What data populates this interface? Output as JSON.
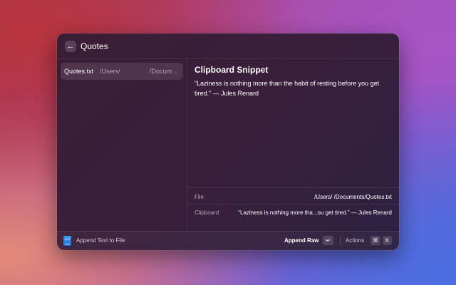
{
  "search": {
    "back_icon": "arrow-left-icon",
    "value": "Quotes",
    "placeholder": ""
  },
  "list": {
    "items": [
      {
        "name": "Quotes.txt",
        "path_start": "/Users/",
        "path_end": "/Docum..."
      }
    ]
  },
  "detail": {
    "title": "Clipboard Snippet",
    "body": "“Laziness is nothing more than the habit of resting before you get tired.” — Jules Renard",
    "metadata": [
      {
        "label": "File",
        "value": "/Users/            /Documents/Quotes.txt"
      },
      {
        "label": "Clipboard",
        "value": "“Laziness is nothing more tha...ou get tired.” — Jules Renard"
      }
    ]
  },
  "footer": {
    "app_icon": "document-app-icon",
    "title": "Append Text to File",
    "primary_action": "Append Raw",
    "primary_key": "↵",
    "actions_label": "Actions",
    "actions_keys": [
      "⌘",
      "K"
    ]
  },
  "colors": {
    "window_bg": "#3a1f3c",
    "accent_icon": "#2f86e6"
  }
}
